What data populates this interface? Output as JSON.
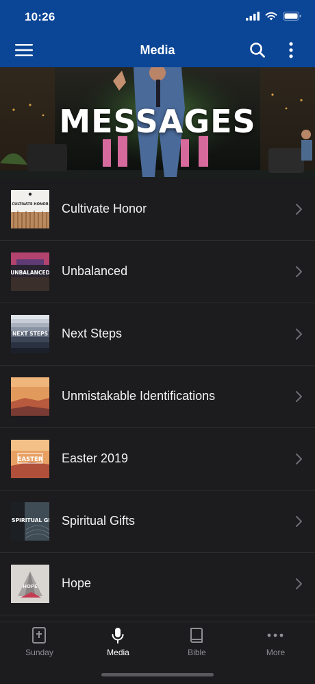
{
  "status": {
    "time": "10:26"
  },
  "nav": {
    "title": "Media",
    "menu_icon": "hamburger-menu-icon",
    "search_icon": "search-icon",
    "more_icon": "vertical-dots-icon"
  },
  "hero": {
    "title": "MESSAGES"
  },
  "messages": [
    {
      "label": "Cultivate Honor",
      "thumb_text": "CULTIVATE HONOR"
    },
    {
      "label": "Unbalanced",
      "thumb_text": "UNBALANCED"
    },
    {
      "label": "Next Steps",
      "thumb_text": "NEXT STEPS"
    },
    {
      "label": "Unmistakable Identifications",
      "thumb_text": ""
    },
    {
      "label": "Easter 2019",
      "thumb_text": "EASTER"
    },
    {
      "label": "Spiritual Gifts",
      "thumb_text": "SPIRITUAL GI"
    },
    {
      "label": "Hope",
      "thumb_text": "HOPE"
    }
  ],
  "tabs": [
    {
      "label": "Sunday",
      "icon": "bible-cross-icon",
      "active": false
    },
    {
      "label": "Media",
      "icon": "microphone-icon",
      "active": true
    },
    {
      "label": "Bible",
      "icon": "book-icon",
      "active": false
    },
    {
      "label": "More",
      "icon": "horizontal-dots-icon",
      "active": false
    }
  ],
  "colors": {
    "brand_blue": "#0a4596",
    "background": "#1c1c1e",
    "inactive_tab": "#8e8e93"
  }
}
